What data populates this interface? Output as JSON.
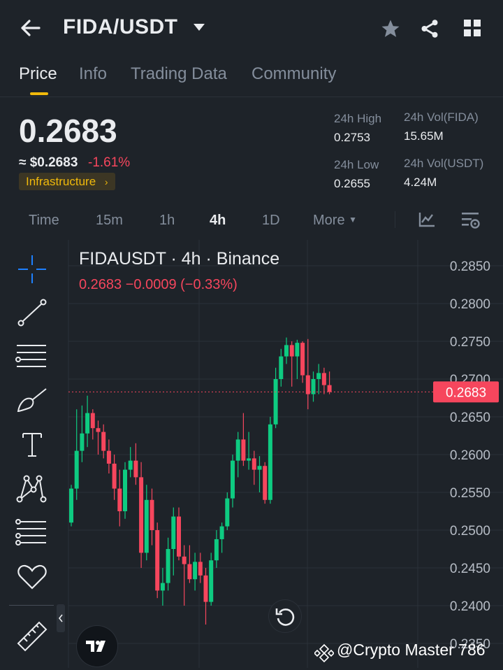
{
  "header": {
    "pair": "FIDA/USDT",
    "back_icon": "arrow-left-icon",
    "dropdown_icon": "caret-down-icon",
    "star_icon": "star-icon",
    "share_icon": "share-icon",
    "grid_icon": "grid-icon"
  },
  "tabs": [
    {
      "label": "Price",
      "active": true
    },
    {
      "label": "Info"
    },
    {
      "label": "Trading Data"
    },
    {
      "label": "Community"
    }
  ],
  "ticker": {
    "price": "0.2683",
    "usd_price": "≈ $0.2683",
    "change": "-1.61%",
    "tag": "Infrastructure",
    "high_label": "24h High",
    "high": "0.2753",
    "low_label": "24h Low",
    "low": "0.2655",
    "vol_base_label": "24h Vol(FIDA)",
    "vol_base": "15.65M",
    "vol_quote_label": "24h Vol(USDT)",
    "vol_quote": "4.24M"
  },
  "intervals": [
    {
      "label": "Time"
    },
    {
      "label": "15m"
    },
    {
      "label": "1h"
    },
    {
      "label": "4h",
      "active": true
    },
    {
      "label": "1D"
    },
    {
      "label": "More"
    }
  ],
  "chart_header": {
    "title": "FIDAUSDT · 4h · Binance",
    "last_line": "0.2683  −0.0009 (−0.33%)"
  },
  "colors": {
    "up": "#0ecb81",
    "down": "#f6465d",
    "accent": "#f0b90b",
    "bg": "#1e2329"
  },
  "chart_data": {
    "type": "candlestick",
    "title": "FIDAUSDT · 4h · Binance",
    "y_ticks": [
      "0.2850",
      "0.2800",
      "0.2750",
      "0.2700",
      "0.2650",
      "0.2600",
      "0.2550",
      "0.2500",
      "0.2450",
      "0.2400",
      "0.2350"
    ],
    "ylim": [
      0.2345,
      0.2865
    ],
    "last_price": 0.2683,
    "last_price_label": "0.2683",
    "candles": [
      {
        "o": 0.251,
        "h": 0.256,
        "l": 0.2505,
        "c": 0.2555
      },
      {
        "o": 0.2555,
        "h": 0.266,
        "l": 0.254,
        "c": 0.2605
      },
      {
        "o": 0.2605,
        "h": 0.2665,
        "l": 0.259,
        "c": 0.2628
      },
      {
        "o": 0.2628,
        "h": 0.2678,
        "l": 0.261,
        "c": 0.2655
      },
      {
        "o": 0.2655,
        "h": 0.266,
        "l": 0.262,
        "c": 0.2635
      },
      {
        "o": 0.2635,
        "h": 0.2645,
        "l": 0.26,
        "c": 0.263
      },
      {
        "o": 0.263,
        "h": 0.264,
        "l": 0.2595,
        "c": 0.2605
      },
      {
        "o": 0.2605,
        "h": 0.262,
        "l": 0.2575,
        "c": 0.2588
      },
      {
        "o": 0.2588,
        "h": 0.26,
        "l": 0.254,
        "c": 0.2555
      },
      {
        "o": 0.2555,
        "h": 0.258,
        "l": 0.2505,
        "c": 0.2525
      },
      {
        "o": 0.2525,
        "h": 0.259,
        "l": 0.2515,
        "c": 0.258
      },
      {
        "o": 0.258,
        "h": 0.261,
        "l": 0.257,
        "c": 0.2592
      },
      {
        "o": 0.2592,
        "h": 0.2615,
        "l": 0.256,
        "c": 0.257
      },
      {
        "o": 0.257,
        "h": 0.259,
        "l": 0.245,
        "c": 0.247
      },
      {
        "o": 0.247,
        "h": 0.256,
        "l": 0.246,
        "c": 0.254
      },
      {
        "o": 0.254,
        "h": 0.2555,
        "l": 0.248,
        "c": 0.25
      },
      {
        "o": 0.25,
        "h": 0.251,
        "l": 0.241,
        "c": 0.242
      },
      {
        "o": 0.242,
        "h": 0.245,
        "l": 0.24,
        "c": 0.243
      },
      {
        "o": 0.243,
        "h": 0.249,
        "l": 0.242,
        "c": 0.2475
      },
      {
        "o": 0.2475,
        "h": 0.253,
        "l": 0.244,
        "c": 0.2518
      },
      {
        "o": 0.2518,
        "h": 0.253,
        "l": 0.246,
        "c": 0.2465
      },
      {
        "o": 0.2465,
        "h": 0.248,
        "l": 0.24,
        "c": 0.2455
      },
      {
        "o": 0.2455,
        "h": 0.248,
        "l": 0.243,
        "c": 0.2435
      },
      {
        "o": 0.2435,
        "h": 0.247,
        "l": 0.242,
        "c": 0.2458
      },
      {
        "o": 0.2458,
        "h": 0.247,
        "l": 0.243,
        "c": 0.244
      },
      {
        "o": 0.244,
        "h": 0.245,
        "l": 0.2375,
        "c": 0.2405
      },
      {
        "o": 0.2405,
        "h": 0.247,
        "l": 0.24,
        "c": 0.246
      },
      {
        "o": 0.246,
        "h": 0.25,
        "l": 0.245,
        "c": 0.2488
      },
      {
        "o": 0.2488,
        "h": 0.251,
        "l": 0.247,
        "c": 0.2505
      },
      {
        "o": 0.2505,
        "h": 0.255,
        "l": 0.25,
        "c": 0.2542
      },
      {
        "o": 0.2542,
        "h": 0.26,
        "l": 0.253,
        "c": 0.2592
      },
      {
        "o": 0.2592,
        "h": 0.263,
        "l": 0.257,
        "c": 0.262
      },
      {
        "o": 0.262,
        "h": 0.2655,
        "l": 0.2585,
        "c": 0.2592
      },
      {
        "o": 0.2592,
        "h": 0.263,
        "l": 0.258,
        "c": 0.2595
      },
      {
        "o": 0.2595,
        "h": 0.2605,
        "l": 0.256,
        "c": 0.258
      },
      {
        "o": 0.258,
        "h": 0.2598,
        "l": 0.255,
        "c": 0.2585
      },
      {
        "o": 0.2585,
        "h": 0.259,
        "l": 0.2535,
        "c": 0.254
      },
      {
        "o": 0.254,
        "h": 0.265,
        "l": 0.2535,
        "c": 0.264
      },
      {
        "o": 0.264,
        "h": 0.2715,
        "l": 0.2635,
        "c": 0.27
      },
      {
        "o": 0.27,
        "h": 0.274,
        "l": 0.269,
        "c": 0.273
      },
      {
        "o": 0.273,
        "h": 0.2755,
        "l": 0.272,
        "c": 0.2745
      },
      {
        "o": 0.2745,
        "h": 0.275,
        "l": 0.269,
        "c": 0.273
      },
      {
        "o": 0.273,
        "h": 0.2752,
        "l": 0.27,
        "c": 0.2748
      },
      {
        "o": 0.2748,
        "h": 0.275,
        "l": 0.2695,
        "c": 0.2705
      },
      {
        "o": 0.2705,
        "h": 0.2753,
        "l": 0.266,
        "c": 0.268
      },
      {
        "o": 0.268,
        "h": 0.271,
        "l": 0.267,
        "c": 0.27
      },
      {
        "o": 0.27,
        "h": 0.272,
        "l": 0.268,
        "c": 0.2708
      },
      {
        "o": 0.2708,
        "h": 0.2715,
        "l": 0.268,
        "c": 0.2692
      },
      {
        "o": 0.2692,
        "h": 0.271,
        "l": 0.268,
        "c": 0.2683
      }
    ]
  },
  "watermark": "@Crypto Master 786"
}
